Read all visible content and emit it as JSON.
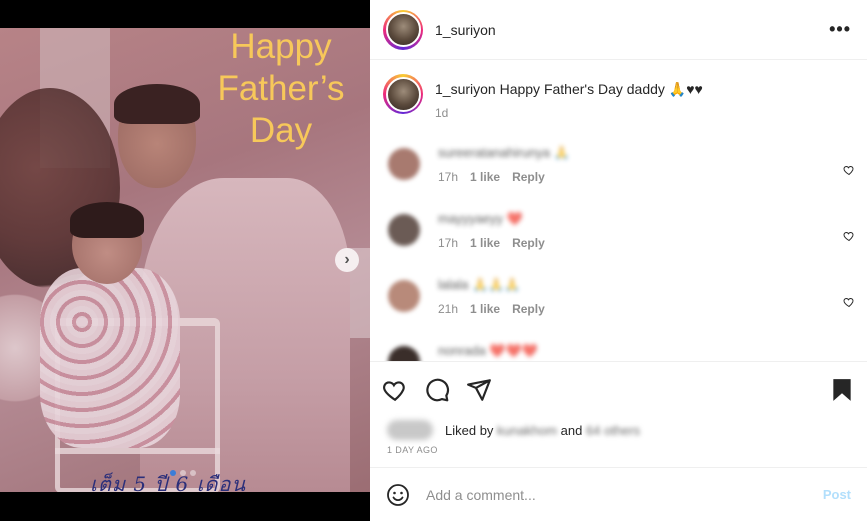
{
  "post": {
    "username": "1_suriyon",
    "more_label": "•••",
    "image_text": {
      "headline": "Happy Father’s Day",
      "handwriting": "เต็ม 5 ปี 6 เดือน"
    },
    "carousel": {
      "slide_count": 3,
      "current_slide": 1
    }
  },
  "caption": {
    "username": "1_suriyon",
    "text": " Happy Father's Day daddy 🙏♥♥",
    "time": "1d"
  },
  "comments": [
    {
      "name": "sureeratanahirunya 🙏",
      "time": "17h",
      "likes": "1 like",
      "reply": "Reply",
      "avatar_color": "#a87a6f"
    },
    {
      "name": "mayyyaeyy ❤️",
      "time": "17h",
      "likes": "1 like",
      "reply": "Reply",
      "avatar_color": "#6b5b55"
    },
    {
      "name": "lalala 🙏🙏🙏",
      "time": "21h",
      "likes": "1 like",
      "reply": "Reply",
      "avatar_color": "#b88a7a"
    },
    {
      "name": "nonrada ❤️❤️❤️",
      "time": "",
      "likes": "",
      "reply": "",
      "avatar_color": "#3a2e2a"
    }
  ],
  "likes": {
    "prefix": "Liked by",
    "liker": "kunakhom",
    "joiner": "and",
    "others": "64 others"
  },
  "date": "1 DAY AGO",
  "add_comment": {
    "placeholder": "Add a comment...",
    "post_label": "Post"
  },
  "colors": {
    "headline": "#f7c85a",
    "post_disabled": "#b2dffc",
    "carousel_active_dot": "#3b7dd8"
  }
}
